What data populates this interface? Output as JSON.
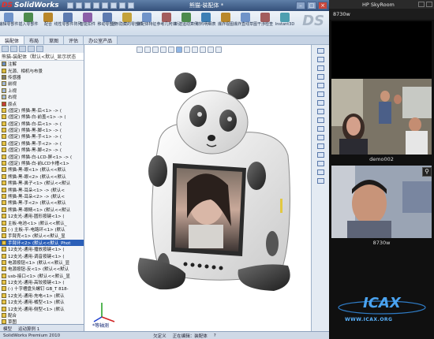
{
  "solidworks": {
    "logo": "SolidWorks",
    "title": "熊猫-装配体 *",
    "brand": "DS",
    "command_buttons": [
      "编辑零部件",
      "插入零部件",
      "配合",
      "线性零部件阵列",
      "智能扣件",
      "移动零部件",
      "显示隐藏的零部件",
      "装配体特征",
      "参考几何体",
      "新建运动算例",
      "材料明细表",
      "爆炸视图",
      "爆炸直线草图",
      "干涉检查",
      "Instant3D"
    ],
    "command_tabs": [
      "装配体",
      "布局",
      "草图",
      "评估",
      "办公室产品"
    ],
    "feature_tree": {
      "filter_label": "熊猫-装配体（默认<默认_显示状态",
      "rows": [
        "注解",
        "光源、相机与布景",
        "传感器",
        "前视",
        "上视",
        "右视",
        "原点",
        "(固定) 熊猫-黑-后<1> -> (",
        "(固定) 熊猫-白-前盖<1> -> (",
        "(固定) 熊猫-白-后<1> -> (",
        "(固定) 熊猫-黑-脚<1> -> (",
        "(固定) 熊猫-黑-手<1> -> (",
        "(固定) 熊猫-黑-手<2> -> (",
        "(固定) 熊猫-黑-脚<2> -> (",
        "(固定) 熊猫-白-LCD-屏<1> -> (",
        "(固定) 熊猫-白-前LCD卡槽<1>",
        "熊猫-黑-眼<1> (默认<<默认",
        "熊猫-黑-眼<2> (默认<<默认",
        "熊猫-黑-鼻子<1> (默认<<默认",
        "熊猫-黑-耳朵<1> -> (默认<",
        "熊猫-黑-耳朵<2> -> (默认<",
        "熊猫-黑-手<2> (默认<<默认",
        "熊猫-黑-眼睛<1> (默认<<默认",
        "12支光-通用-圆形按键<1> (",
        "主板-电池<1> (默认<<默认_",
        "(-) 主板-平-电路环<1> (默认",
        "手臂壳<1> (默认<<默认_显",
        "手臂环<2> (默认<<默认_Phot",
        "12支光-通用-播放按键<1> (",
        "12支光-通用-调音按键<1> (",
        "电源按钮<1> (默认<<默认_显",
        "电源按钮-反<1> (默认<<默认",
        "usb-接口<1> (默认<<默认_显",
        "12支光-通用-高较按键<1> (",
        "(-) 十字槽盘头螺钉 GB_T 818-",
        "12支光-通用-充电<1> (默认",
        "12支光-通用-橘型<1> (默认",
        "12支光-通用-侧型<1> (默认",
        "配合",
        "草图"
      ],
      "selected_index": 27,
      "bottom_tabs": [
        "模型",
        "运动算例 1"
      ]
    },
    "triad_label": "*等轴测",
    "status": {
      "product": "SolidWorks Premium 2010",
      "defined": "欠定义",
      "editing": "正在编辑：装配体",
      "help": "?"
    }
  },
  "skyroom": {
    "title": "HP SkyRoom",
    "user": "8730w",
    "participants": [
      {
        "name": "demo002"
      },
      {
        "name": "8730w"
      }
    ],
    "logo_text": "ICAX",
    "logo_url": "WWW.ICAX.ORG"
  },
  "colors": {
    "sw_title": "#34507a",
    "selection": "#2b5fb8",
    "sky_bg": "#101010",
    "icax_blue": "#5ab4ff"
  }
}
